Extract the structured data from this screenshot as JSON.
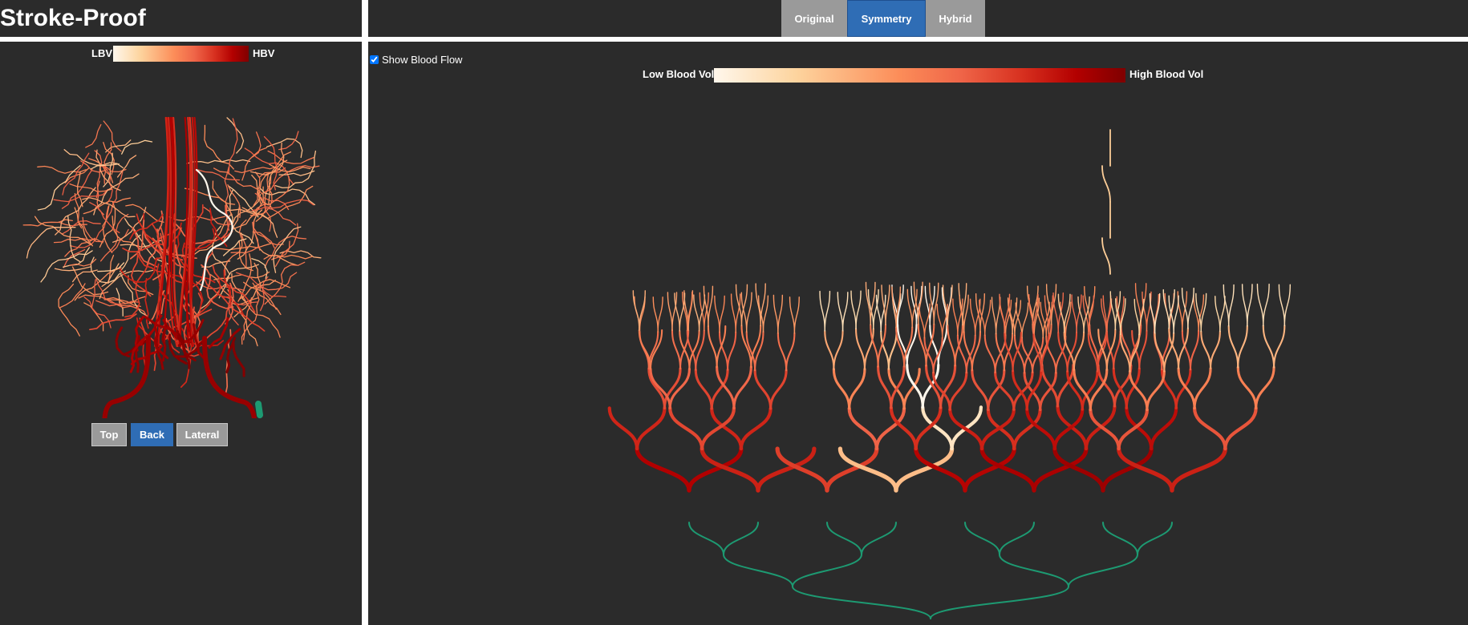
{
  "app": {
    "title": "Stroke-Proof"
  },
  "tabs": [
    {
      "label": "Original",
      "active": false
    },
    {
      "label": "Symmetry",
      "active": true
    },
    {
      "label": "Hybrid",
      "active": false
    }
  ],
  "left_panel": {
    "legend": {
      "low_label": "LBV",
      "high_label": "HBV"
    },
    "view_buttons": [
      {
        "label": "Top",
        "active": false
      },
      {
        "label": "Back",
        "active": true
      },
      {
        "label": "Lateral",
        "active": false
      }
    ]
  },
  "main_panel": {
    "show_blood_flow": {
      "label": "Show Blood Flow",
      "checked": true
    },
    "legend": {
      "low_label": "Low Blood Vol",
      "high_label": "High Blood Vol"
    }
  },
  "colors": {
    "panel_bg": "#2b2b2b",
    "active_blue": "#2f6db5",
    "inactive_gray": "#9a9a9a",
    "tree_root": "#1d9a72",
    "scale": [
      "#fff7ec",
      "#fdd49e",
      "#fc8d59",
      "#ef6548",
      "#d7301f",
      "#b30000",
      "#7f0000"
    ]
  }
}
